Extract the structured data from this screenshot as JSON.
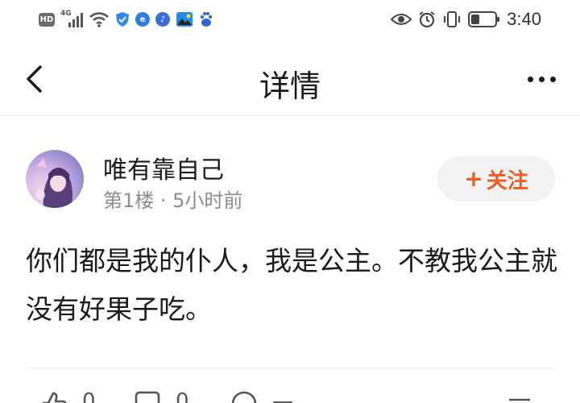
{
  "status_bar": {
    "hd_label": "HD",
    "network_label": "4G",
    "time": "3:40"
  },
  "header": {
    "title": "详情",
    "back_icon": "chevron-left-icon",
    "more_icon": "more-dots-icon"
  },
  "post": {
    "author": "唯有靠自己",
    "meta": "第1楼 · 5小时前",
    "follow_label": "关注",
    "follow_color": "#f15a22",
    "content": "你们都是我的仆人，我是公主。不教我公主就没有好果子吃。"
  },
  "actions": {
    "like_icon": "thumbs-up-icon",
    "reply_icon": "comment-icon",
    "share_icon": "share-icon"
  }
}
